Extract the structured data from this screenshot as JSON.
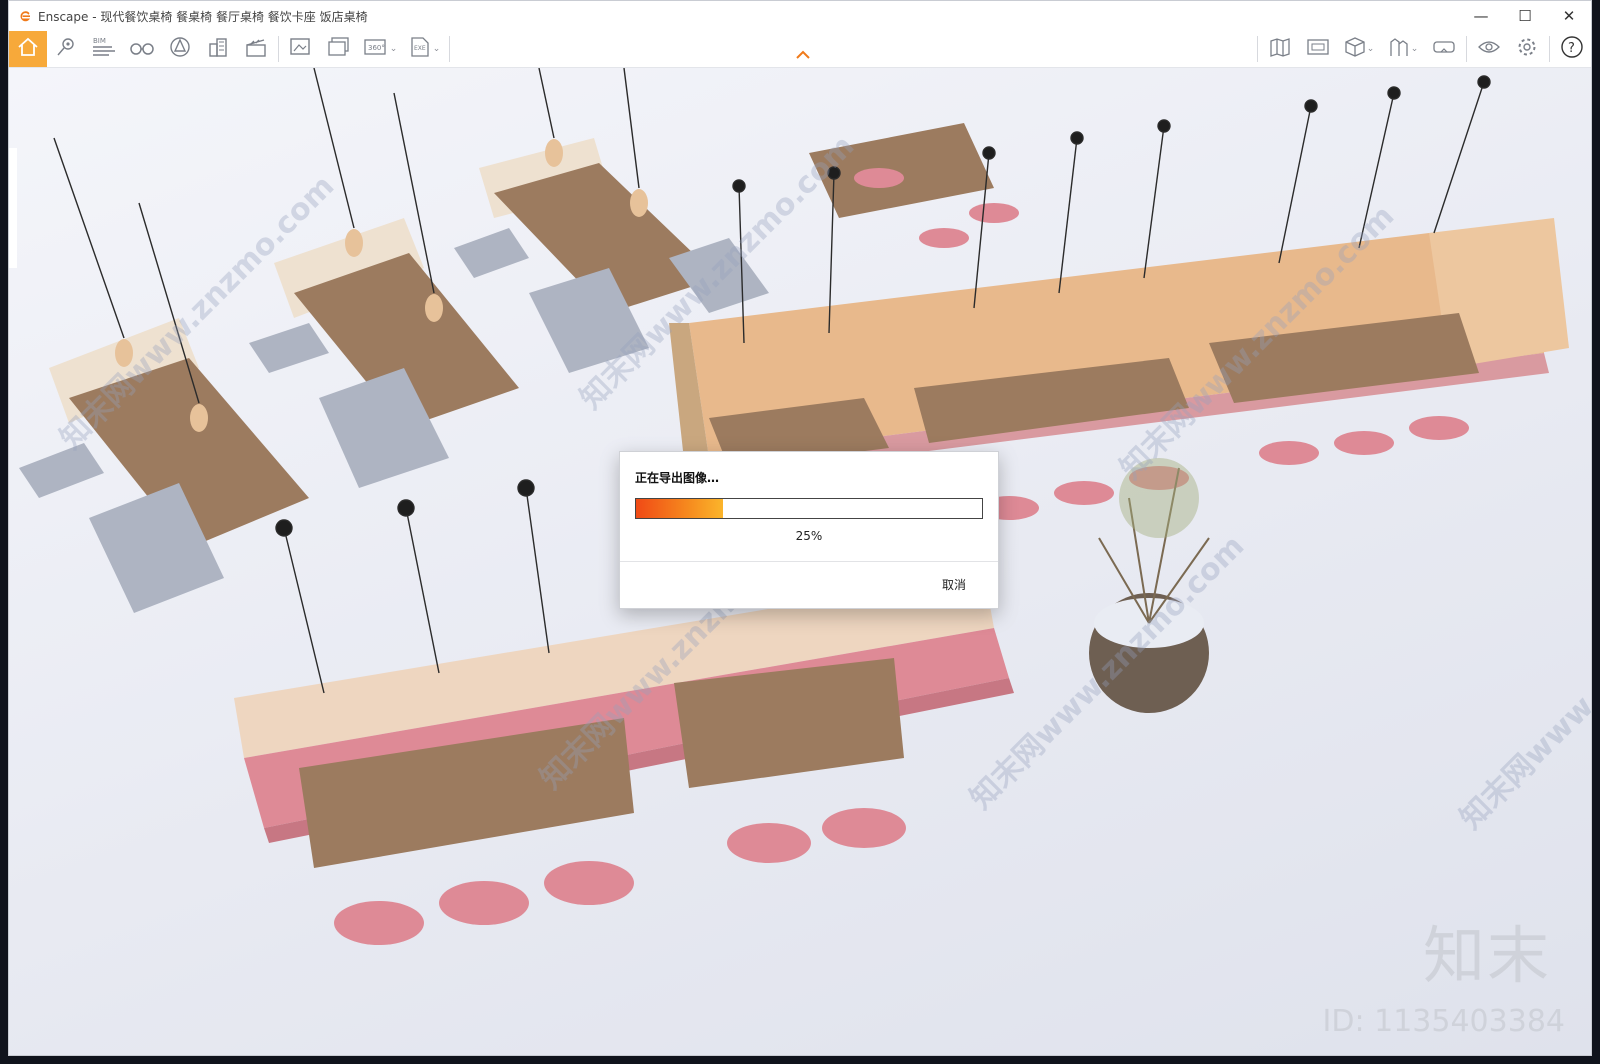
{
  "window": {
    "title": "Enscape - 现代餐饮桌椅 餐桌椅 餐厅桌椅 餐饮卡座 饭店桌椅",
    "controls": {
      "minimize": "—",
      "maximize": "☐",
      "close": "✕"
    }
  },
  "toolbar": {
    "left_buttons": [
      {
        "name": "home-icon",
        "active": true
      },
      {
        "name": "location-pin-icon",
        "active": false
      },
      {
        "name": "bim-icon",
        "label": "BIM",
        "active": false
      },
      {
        "name": "binoculars-icon",
        "active": false
      },
      {
        "name": "asset-library-icon",
        "active": false
      },
      {
        "name": "buildings-icon",
        "active": false
      },
      {
        "name": "clapperboard-icon",
        "active": false
      },
      {
        "name": "screenshot-icon",
        "active": false
      },
      {
        "name": "batch-render-icon",
        "active": false
      },
      {
        "name": "panorama-360-icon",
        "label": "360°",
        "active": false,
        "dropdown": true
      },
      {
        "name": "export-exe-icon",
        "label": "EXE",
        "active": false,
        "dropdown": true
      }
    ],
    "right_buttons": [
      {
        "name": "map-icon"
      },
      {
        "name": "orthographic-view-icon"
      },
      {
        "name": "cube-view-icon",
        "dropdown": true
      },
      {
        "name": "view-management-icon",
        "dropdown": true
      },
      {
        "name": "vr-headset-icon"
      },
      {
        "name": "visual-settings-eye-icon"
      },
      {
        "name": "settings-gear-icon"
      },
      {
        "name": "help-icon",
        "label": "?"
      }
    ]
  },
  "viewport": {
    "watermark_text": "知末网www.znzmo.com",
    "brand": "知末",
    "model_id": "ID: 1135403384"
  },
  "dialog": {
    "title": "正在导出图像…",
    "progress": 0.25,
    "progress_label": "25%",
    "cancel_label": "取消"
  },
  "colors": {
    "accent": "#f7a93a",
    "progress_start": "#f04a16",
    "progress_end": "#fbb52b",
    "seat_pink": "#de8a96",
    "wood": "#e8b98c",
    "table_top": "#9c7b5f",
    "bench": "#aeb4c2"
  }
}
